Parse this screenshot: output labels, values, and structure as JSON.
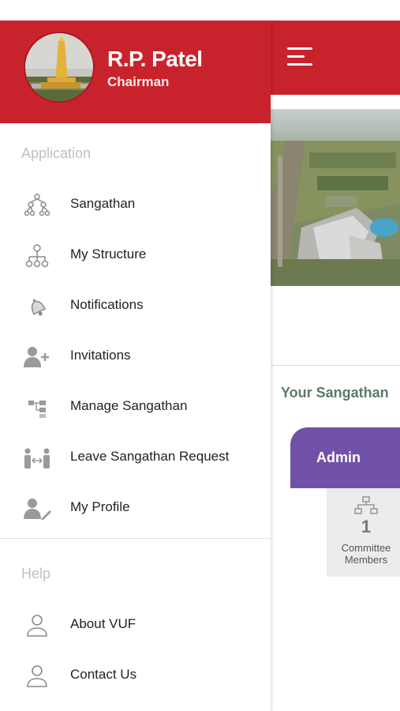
{
  "user": {
    "name": "R.P. Patel",
    "role": "Chairman"
  },
  "drawer": {
    "application_title": "Application",
    "help_title": "Help",
    "app_items": [
      {
        "label": "Sangathan",
        "icon": "org-chart-icon"
      },
      {
        "label": "My Structure",
        "icon": "structure-icon"
      },
      {
        "label": "Notifications",
        "icon": "bell-icon"
      },
      {
        "label": "Invitations",
        "icon": "add-user-icon"
      },
      {
        "label": "Manage Sangathan",
        "icon": "hierarchy-icon"
      },
      {
        "label": "Leave Sangathan Request",
        "icon": "leave-request-icon"
      },
      {
        "label": "My Profile",
        "icon": "edit-profile-icon"
      }
    ],
    "help_items": [
      {
        "label": "About VUF",
        "icon": "user-outline-icon"
      },
      {
        "label": "Contact Us",
        "icon": "user-outline-icon"
      }
    ]
  },
  "main": {
    "section_title": "Your Sangathan",
    "admin_label": "Admin",
    "stat": {
      "value": "1",
      "label": "Committee Members",
      "icon": "network-icon"
    }
  },
  "colors": {
    "header": "#c8232c",
    "admin_card": "#7151a8",
    "section_title": "#5d7a64"
  }
}
